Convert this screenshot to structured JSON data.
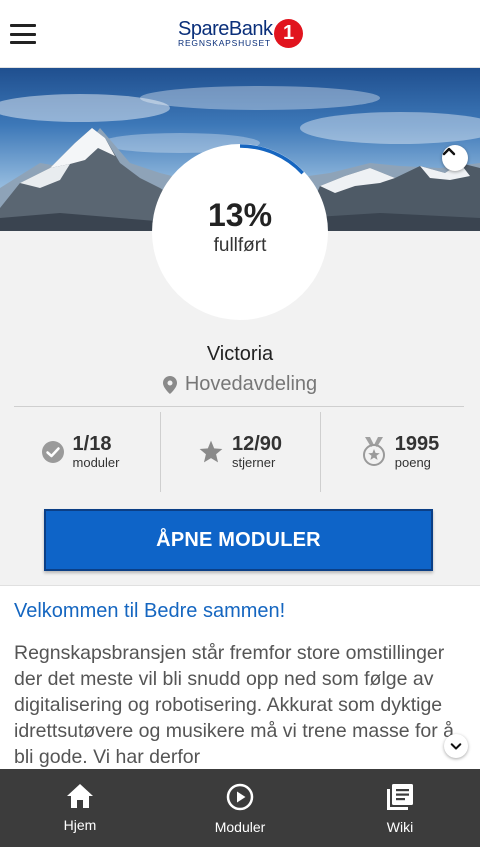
{
  "header": {
    "menu_icon": "hamburger-menu-icon",
    "logo_name": "SpareBank",
    "logo_badge": "1",
    "logo_sub": "REGNSKAPSHUSET"
  },
  "hero": {
    "image": "mountain-landscape",
    "collapse_icon": "chevron-up-icon"
  },
  "progress": {
    "percent_text": "13%",
    "percent_value": 13,
    "label": "fullført",
    "accent": "#1565c0"
  },
  "profile": {
    "name": "Victoria",
    "department": "Hovedavdeling",
    "department_icon": "location-pin-icon"
  },
  "stats": [
    {
      "icon": "check-circle-icon",
      "value": "1/18",
      "label": "moduler"
    },
    {
      "icon": "star-icon",
      "value": "12/90",
      "label": "stjerner"
    },
    {
      "icon": "medal-icon",
      "value": "1995",
      "label": "poeng"
    }
  ],
  "actions": {
    "open_modules": "ÅPNE MODULER",
    "button_color": "#0e64c8"
  },
  "article": {
    "title": "Velkommen til Bedre sammen!",
    "body": "Regnskapsbransjen står fremfor store omstillinger der det meste vil bli snudd opp ned som følge av digitalisering og robotisering. Akkurat som dyktige idrettsutøvere og musikere må vi trene masse for å bli gode. Vi har derfor",
    "scroll_icon": "chevron-down-icon"
  },
  "nav": [
    {
      "icon": "home-icon",
      "label": "Hjem"
    },
    {
      "icon": "play-circle-icon",
      "label": "Moduler"
    },
    {
      "icon": "library-icon",
      "label": "Wiki"
    }
  ]
}
